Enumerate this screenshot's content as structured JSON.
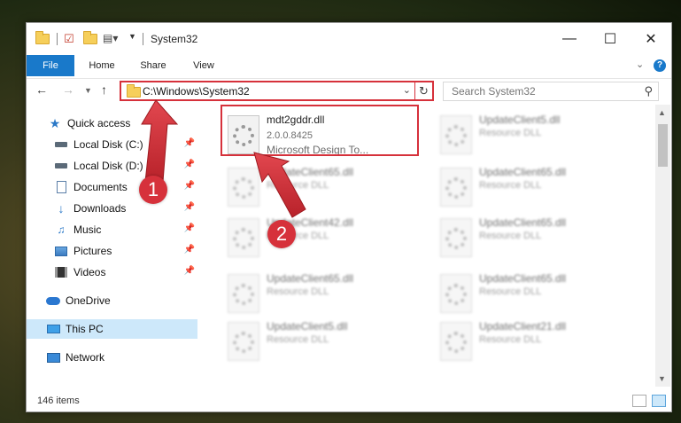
{
  "window": {
    "title": "System32"
  },
  "ribbon": {
    "tabs": [
      "File",
      "Home",
      "Share",
      "View"
    ],
    "help_label": "?"
  },
  "navbar": {
    "address": "C:\\Windows\\System32",
    "search_placeholder": "Search System32"
  },
  "sidebar": {
    "items": [
      {
        "label": "Quick access",
        "icon": "star-icon"
      },
      {
        "label": "Local Disk (C:)",
        "icon": "drive-icon",
        "pinned": true
      },
      {
        "label": "Local Disk (D:)",
        "icon": "drive-icon",
        "pinned": true
      },
      {
        "label": "Documents",
        "icon": "documents-icon",
        "pinned": true
      },
      {
        "label": "Downloads",
        "icon": "download-icon",
        "pinned": true
      },
      {
        "label": "Music",
        "icon": "music-icon",
        "pinned": true
      },
      {
        "label": "Pictures",
        "icon": "pictures-icon",
        "pinned": true
      },
      {
        "label": "Videos",
        "icon": "videos-icon",
        "pinned": true
      },
      {
        "label": "OneDrive",
        "icon": "onedrive-icon"
      },
      {
        "label": "This PC",
        "icon": "this-pc-icon",
        "selected": true
      },
      {
        "label": "Network",
        "icon": "network-icon"
      }
    ]
  },
  "files": {
    "highlighted": {
      "name": "mdt2gddr.dll",
      "version": "2.0.0.8425",
      "company": "Microsoft Design To..."
    },
    "others": [
      {
        "name": "UpdateClient5.dll",
        "type": "Resource DLL"
      },
      {
        "name": "UpdateClient65.dll",
        "type": "Resource DLL"
      },
      {
        "name": "UpdateClient65.dll",
        "type": "Resource DLL"
      },
      {
        "name": "UpdateClient42.dll",
        "type": "Resource DLL"
      },
      {
        "name": "UpdateClient65.dll",
        "type": "Resource DLL"
      },
      {
        "name": "UpdateClient65.dll",
        "type": "Resource DLL"
      },
      {
        "name": "UpdateClient65.dll",
        "type": "Resource DLL"
      },
      {
        "name": "UpdateClient5.dll",
        "type": "Resource DLL"
      },
      {
        "name": "UpdateClient21.dll",
        "type": "Resource DLL"
      }
    ]
  },
  "status": {
    "item_count": "146 items"
  },
  "annotations": {
    "step1": "1",
    "step2": "2"
  },
  "colors": {
    "accent": "#1979ca",
    "highlight": "#d6313b",
    "selected": "#cde8fa"
  }
}
